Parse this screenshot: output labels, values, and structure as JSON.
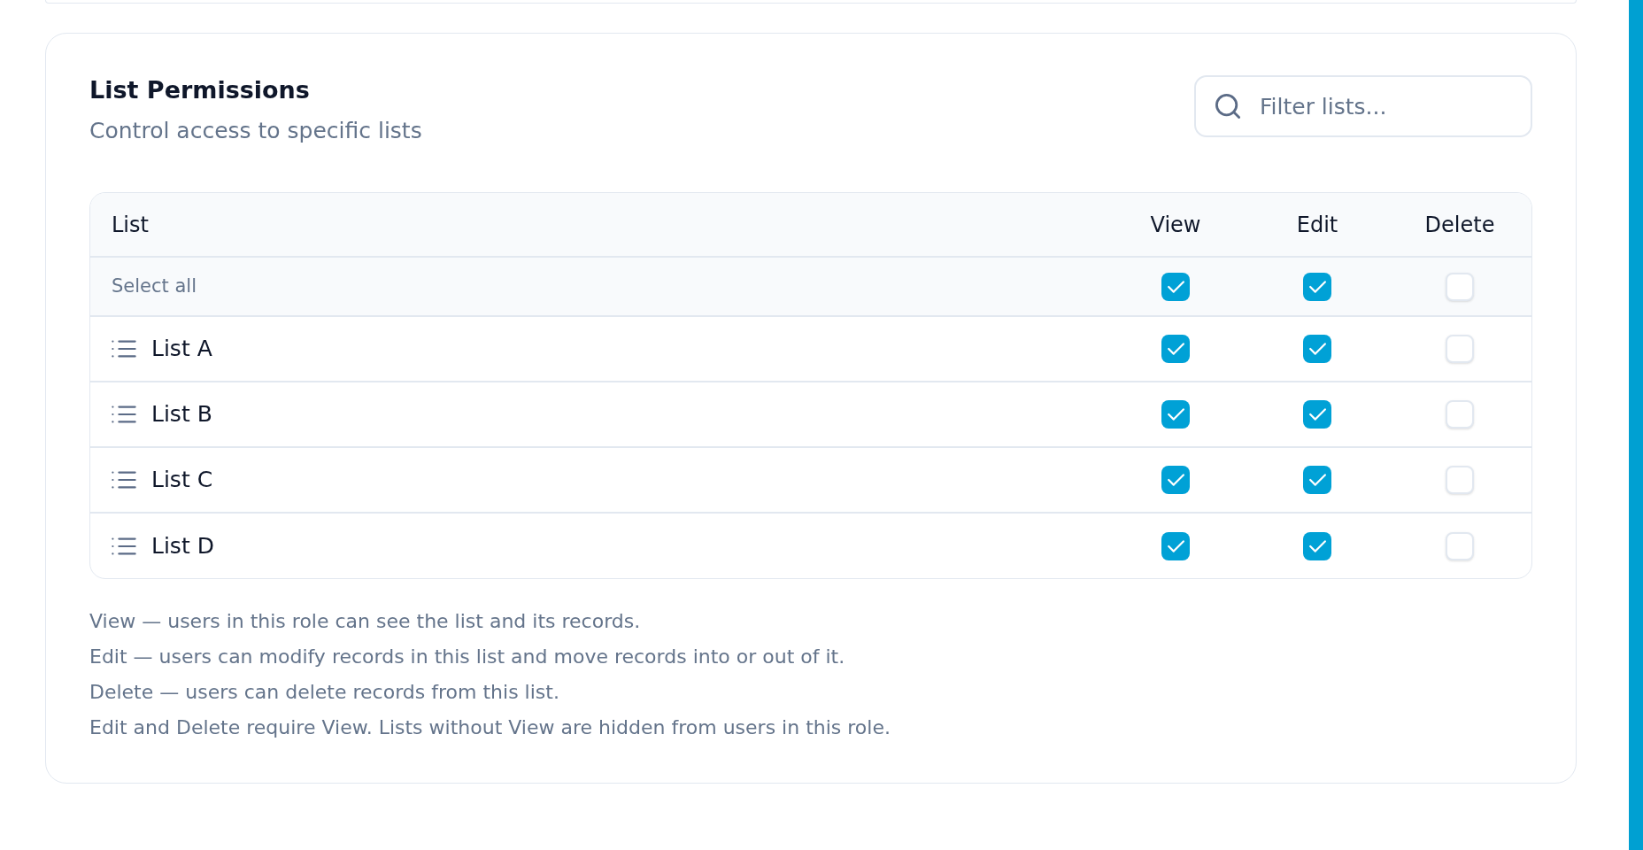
{
  "panel": {
    "title": "List Permissions",
    "subtitle": "Control access to specific lists",
    "filter": {
      "placeholder": "Filter lists..."
    }
  },
  "table": {
    "columns": [
      "List",
      "View",
      "Edit",
      "Delete"
    ],
    "select_all": {
      "label": "Select all",
      "permissions": [
        {
          "checked": true
        },
        {
          "checked": true
        },
        {
          "checked": false
        }
      ]
    },
    "rows": [
      {
        "name": "List A",
        "permissions": [
          {
            "checked": true
          },
          {
            "checked": true
          },
          {
            "checked": false
          }
        ]
      },
      {
        "name": "List B",
        "permissions": [
          {
            "checked": true
          },
          {
            "checked": true
          },
          {
            "checked": false
          }
        ]
      },
      {
        "name": "List C",
        "permissions": [
          {
            "checked": true
          },
          {
            "checked": true
          },
          {
            "checked": false
          }
        ]
      },
      {
        "name": "List D",
        "permissions": [
          {
            "checked": true
          },
          {
            "checked": true
          },
          {
            "checked": false
          }
        ]
      }
    ]
  },
  "notes": [
    "View — users in this role can see the list and its records.",
    "Edit — users can modify records in this list and move records into or out of it.",
    "Delete — users can delete records from this list.",
    "Edit and Delete require View. Lists without View are hidden from users in this role."
  ]
}
